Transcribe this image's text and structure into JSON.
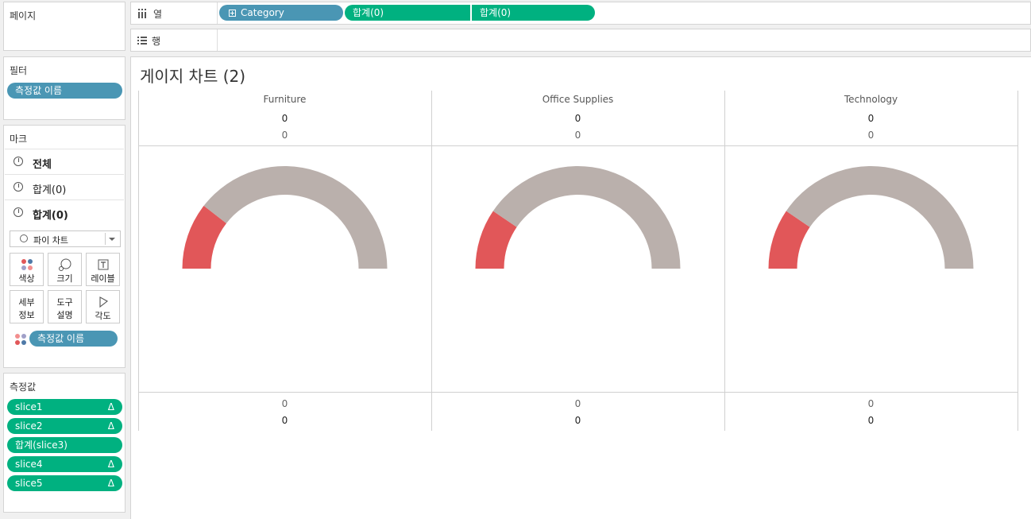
{
  "pages": {
    "title": "페이지"
  },
  "filters": {
    "title": "필터",
    "pill": "측정값 이름"
  },
  "marks": {
    "title": "마크",
    "rows": [
      "전체",
      "합계(0)",
      "합계(0)"
    ],
    "mark_type": "파이 차트",
    "buttons": {
      "color": "색상",
      "size": "크기",
      "label": "레이블",
      "detail_1": "세부",
      "detail_2": "정보",
      "tooltip_1": "도구",
      "tooltip_2": "설명",
      "angle": "각도"
    },
    "color_pill": "측정값 이름"
  },
  "measures": {
    "title": "측정값",
    "items": [
      "slice1",
      "slice2",
      "합계(slice3)",
      "slice4",
      "slice5"
    ],
    "delta": "Δ"
  },
  "columns": {
    "label": "열",
    "pills": [
      "Category",
      "합계(0)",
      "합계(0)"
    ]
  },
  "rows": {
    "label": "행"
  },
  "view": {
    "title": "게이지 차트 (2)",
    "categories": [
      {
        "name": "Furniture",
        "top_1": "0",
        "top_2": "0",
        "bottom_1": "0",
        "bottom_2": "0"
      },
      {
        "name": "Office Supplies",
        "top_1": "0",
        "top_2": "0",
        "bottom_1": "0",
        "bottom_2": "0"
      },
      {
        "name": "Technology",
        "top_1": "0",
        "top_2": "0",
        "bottom_1": "0",
        "bottom_2": "0"
      }
    ]
  },
  "chart_data": {
    "type": "pie",
    "categories": [
      "Furniture",
      "Office Supplies",
      "Technology"
    ],
    "gauge_fill_fraction_of_half": [
      0.21,
      0.19,
      0.19
    ],
    "colors": {
      "filled": "#e15759",
      "remaining": "#bab0ac"
    }
  }
}
